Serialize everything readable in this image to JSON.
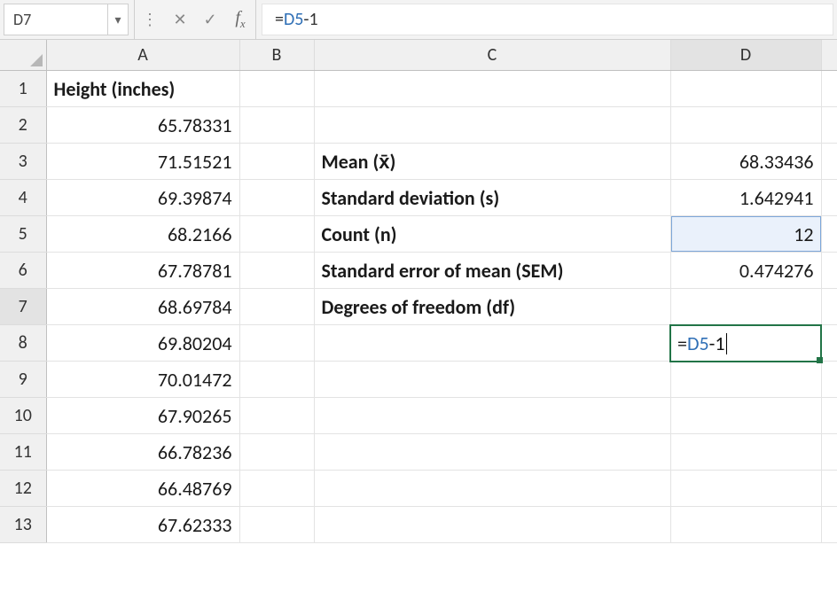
{
  "name_box": "D7",
  "formula_bar": {
    "raw": "=D5-1",
    "ref": "D5",
    "prefix": "=",
    "suffix": "-1"
  },
  "columns": [
    "A",
    "B",
    "C",
    "D"
  ],
  "active_col": "D",
  "active_row": 7,
  "rows": [
    {
      "r": 1,
      "A": "Height (inches)",
      "Abold": true,
      "C": "",
      "D": ""
    },
    {
      "r": 2,
      "A": "65.78331",
      "C": "",
      "D": ""
    },
    {
      "r": 3,
      "A": "71.51521",
      "C": "Mean (x̄)",
      "D": "68.33436"
    },
    {
      "r": 4,
      "A": "69.39874",
      "C": "Standard deviation (s)",
      "D": "1.642941"
    },
    {
      "r": 5,
      "A": "68.2166",
      "C": "Count (n)",
      "D": "12",
      "Dprecedent": true
    },
    {
      "r": 6,
      "A": "67.78781",
      "C": "Standard error of mean (SEM)",
      "D": "0.474276"
    },
    {
      "r": 7,
      "A": "68.69784",
      "C": "Degrees of freedom (df)",
      "D": "",
      "Dedit": true
    },
    {
      "r": 8,
      "A": "69.80204",
      "C": "",
      "D": ""
    },
    {
      "r": 9,
      "A": "70.01472",
      "C": "",
      "D": ""
    },
    {
      "r": 10,
      "A": "67.90265",
      "C": "",
      "D": ""
    },
    {
      "r": 11,
      "A": "66.78236",
      "C": "",
      "D": ""
    },
    {
      "r": 12,
      "A": "66.48769",
      "C": "",
      "D": ""
    },
    {
      "r": 13,
      "A": "67.62333",
      "C": "",
      "D": ""
    }
  ],
  "edit_cell": {
    "prefix": "=",
    "ref": "D5",
    "suffix": "-1"
  },
  "chart_data": {
    "type": "table",
    "title": "Height (inches) sample with summary statistics",
    "series": [
      {
        "name": "Height (inches)",
        "values": [
          65.78331,
          71.51521,
          69.39874,
          68.2166,
          67.78781,
          68.69784,
          69.80204,
          70.01472,
          67.90265,
          66.78236,
          66.48769,
          67.62333
        ]
      }
    ],
    "summary": {
      "Mean (x̄)": 68.33436,
      "Standard deviation (s)": 1.642941,
      "Count (n)": 12,
      "Standard error of mean (SEM)": 0.474276,
      "Degrees of freedom (df)": "=D5-1"
    }
  }
}
